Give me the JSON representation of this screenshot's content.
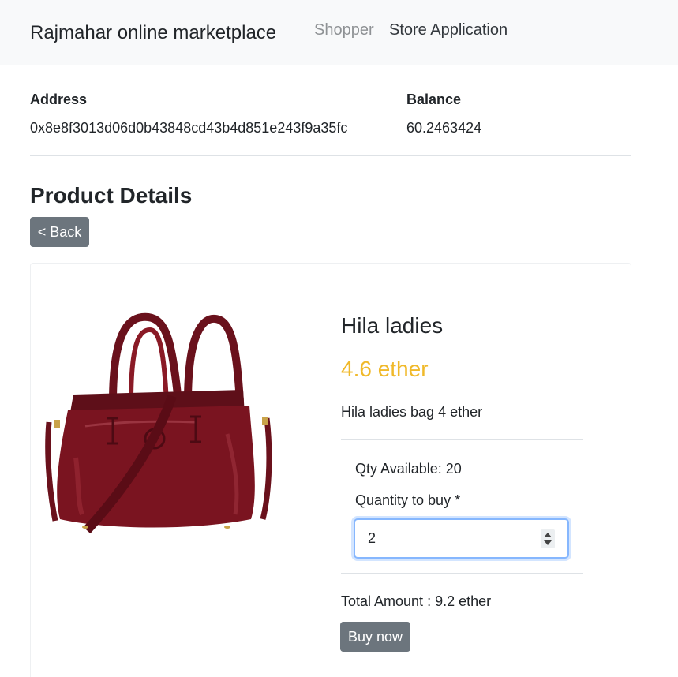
{
  "nav": {
    "brand": "Rajmahar online marketplace",
    "links": [
      "Shopper",
      "Store Application"
    ]
  },
  "account": {
    "address_label": "Address",
    "address_value": "0x8e8f3013d06d0b43848cd43b4d851e243f9a35fc",
    "balance_label": "Balance",
    "balance_value": "60.2463424"
  },
  "page": {
    "title": "Product Details",
    "back_label": "< Back"
  },
  "product": {
    "name": "Hila ladies",
    "price": "4.6 ether",
    "description": "Hila ladies bag 4 ether",
    "image_icon": "handbag-icon",
    "qty_available": "Qty Available: 20",
    "qty_label": "Quantity to buy *",
    "qty_value": "2",
    "total": "Total Amount :  9.2 ether",
    "buy_label": "Buy now"
  },
  "colors": {
    "price": "#f0b92a",
    "button": "#6c757d",
    "navbar_bg": "#f8f9fa",
    "bag": "#7a1420"
  }
}
